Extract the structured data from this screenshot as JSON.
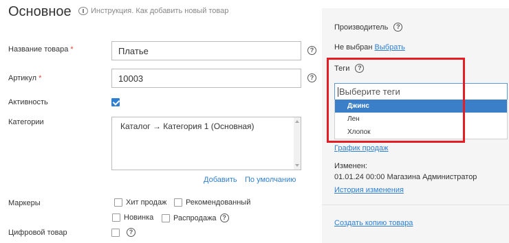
{
  "header": {
    "title": "Основное",
    "instruction": "Инструкция. Как добавить новый товар"
  },
  "form": {
    "product_name_label": "Название товара",
    "product_name_value": "Платье",
    "article_label": "Артикул",
    "article_value": "10003",
    "active_label": "Активность",
    "categories_label": "Категории",
    "categories_value": "Каталог → Категория 1 (Основная)",
    "add_link": "Добавить",
    "default_link": "По умолчанию",
    "markers_label": "Маркеры",
    "markers": [
      "Хит продаж",
      "Рекомендованный",
      "Новинка",
      "Распродажа"
    ],
    "digital_label": "Цифровой товар",
    "required_mark": "*",
    "help_glyph": "?"
  },
  "sidebar": {
    "manufacturer_label": "Производитель",
    "manufacturer_value": "Не выбран",
    "choose_link": "Выбрать",
    "tags_label": "Теги",
    "tags_placeholder": "Выберите теги",
    "tag_options": [
      "Джинс",
      "Лен",
      "Хлопок"
    ],
    "sales_chart_link": "График продаж",
    "changed_label": "Изменен:",
    "changed_value": "01.01.24 00:00 Магазина Администратор",
    "history_link": "История изменения",
    "copy_link": "Создать копию товара"
  },
  "colors": {
    "accent": "#2f7fd1",
    "highlight": "#e51c23",
    "selected_option": "#3c7fc9"
  }
}
